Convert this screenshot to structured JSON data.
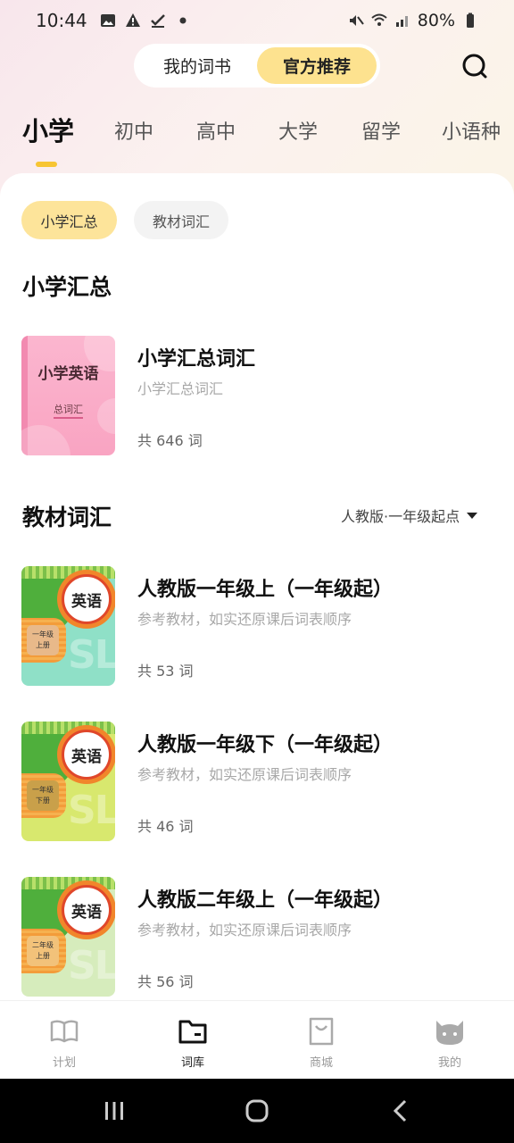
{
  "status_bar": {
    "time": "10:44",
    "battery": "80%"
  },
  "header": {
    "segments": [
      "我的词书",
      "官方推荐"
    ],
    "active_segment": 1
  },
  "level_tabs": [
    "小学",
    "初中",
    "高中",
    "大学",
    "留学",
    "小语种"
  ],
  "active_level": 0,
  "chips": [
    "小学汇总",
    "教材词汇"
  ],
  "summary_section": {
    "title": "小学汇总",
    "book": {
      "cover_title": "小学英语",
      "cover_subtitle": "总词汇",
      "title": "小学汇总词汇",
      "desc": "小学汇总词汇",
      "count": "共 646 词"
    }
  },
  "textbook_section": {
    "title": "教材词汇",
    "sort_label": "人教版·一年级起点",
    "books": [
      {
        "badge": "英语",
        "cover_label": "一年级上册",
        "cover_text": "SL",
        "title": "人教版一年级上（一年级起）",
        "desc": "参考教材，如实还原课后词表顺序",
        "count": "共 53 词",
        "color": "#8fe0c7"
      },
      {
        "badge": "英语",
        "cover_label": "一年级下册",
        "cover_text": "SL",
        "title": "人教版一年级下（一年级起）",
        "desc": "参考教材，如实还原课后词表顺序",
        "count": "共 46 词",
        "color": "#d8e86e"
      },
      {
        "badge": "英语",
        "cover_label": "二年级上册",
        "cover_text": "SL",
        "title": "人教版二年级上（一年级起）",
        "desc": "参考教材，如实还原课后词表顺序",
        "count": "共 56 词",
        "color": "#d6ecbc"
      }
    ]
  },
  "bottom_nav": [
    {
      "label": "计划",
      "icon": "book-icon"
    },
    {
      "label": "词库",
      "icon": "folder-icon"
    },
    {
      "label": "商城",
      "icon": "shopping-bag-icon"
    },
    {
      "label": "我的",
      "icon": "cat-face-icon"
    }
  ],
  "active_nav": 1,
  "colors": {
    "accent": "#fde28f",
    "tab_indicator": "#f7c533"
  }
}
